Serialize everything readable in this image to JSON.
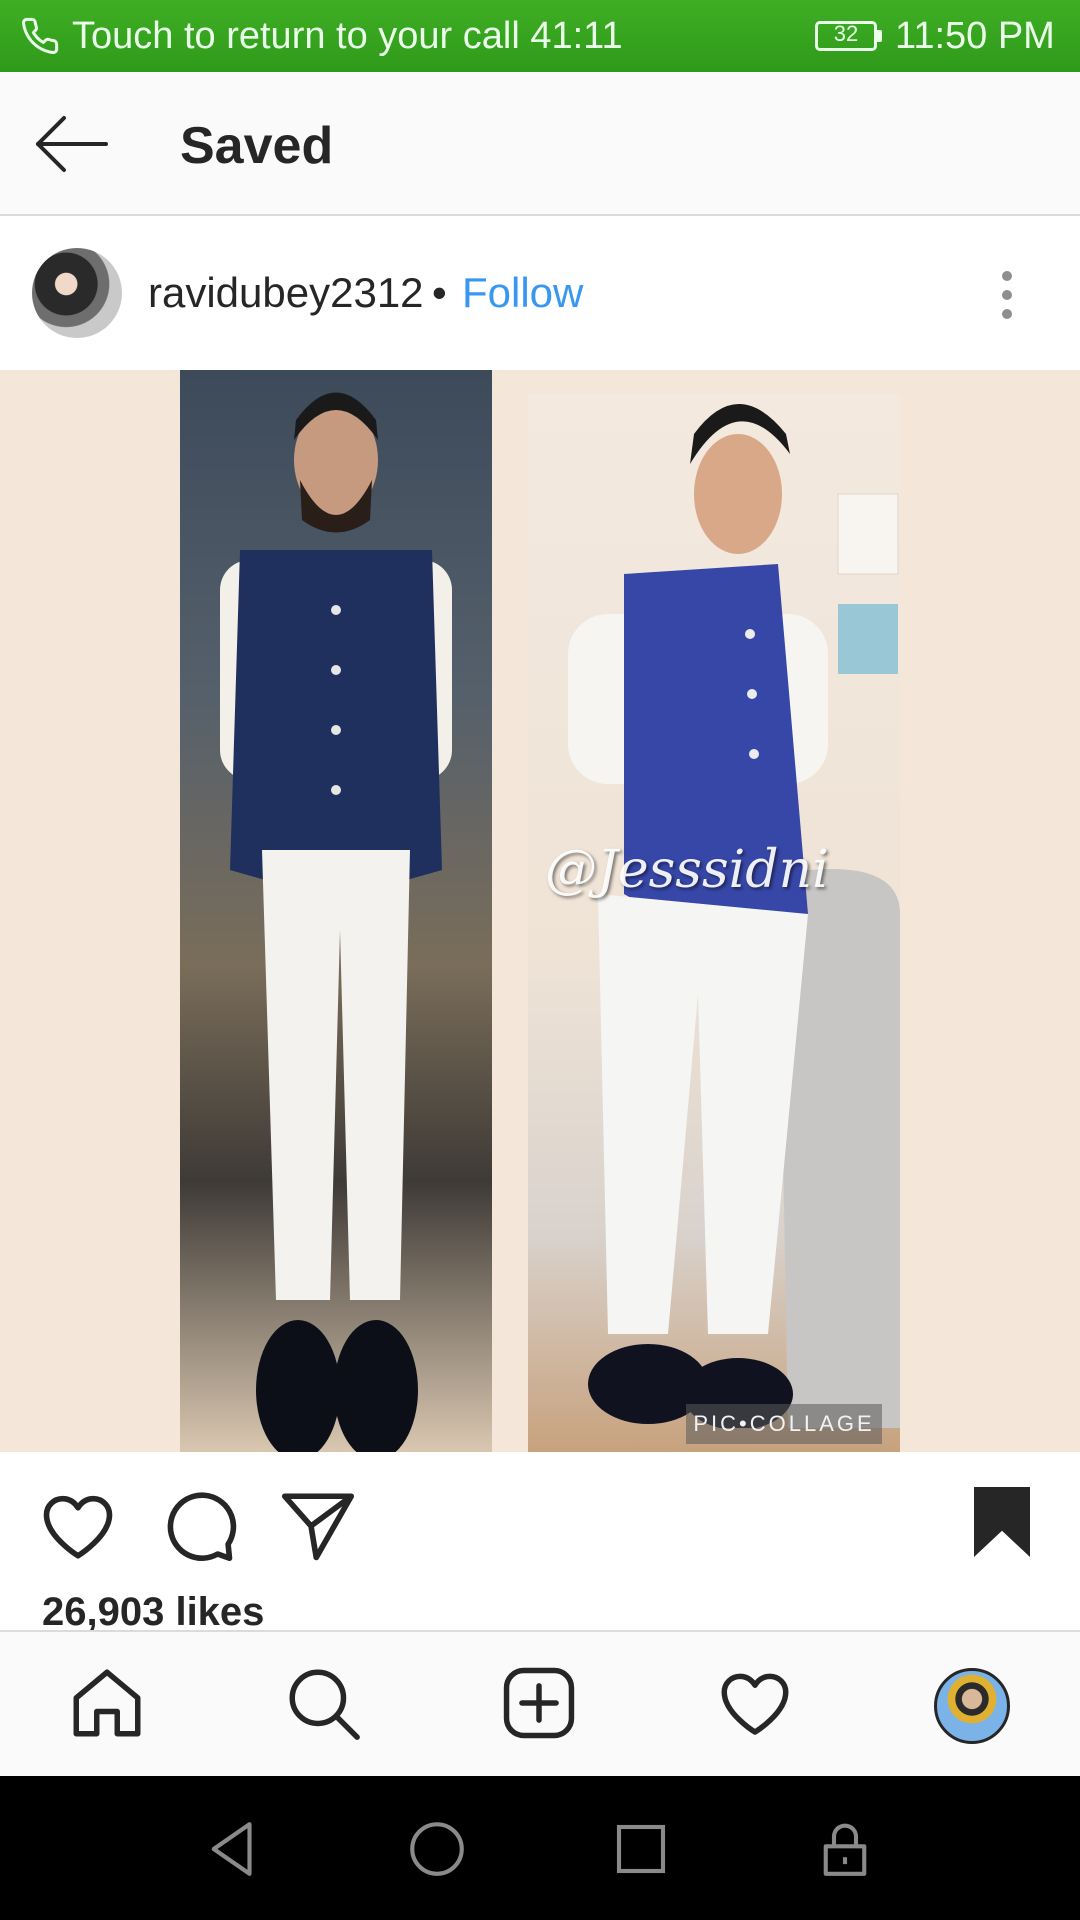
{
  "status_bar": {
    "call_text": "Touch to return to your call",
    "call_timer": "41:11",
    "battery": "32",
    "time": "11:50 PM"
  },
  "header": {
    "title": "Saved"
  },
  "post": {
    "username": "ravidubey2312",
    "separator": "•",
    "follow_label": "Follow",
    "image_watermark": "@Jesssidni",
    "collage_tag": "PIC•COLLAGE",
    "likes": "26,903 likes",
    "saved": true
  },
  "bottom_nav": {
    "items": [
      "home-icon",
      "search-icon",
      "add-post-icon",
      "activity-heart-icon",
      "profile-avatar"
    ]
  },
  "system_nav": {
    "items": [
      "back-icon",
      "home-circle-icon",
      "recents-icon",
      "lock-icon"
    ]
  },
  "colors": {
    "status_bar": "#3fae24",
    "follow_link": "#3897f0",
    "text": "#262626",
    "image_bg": "#f5e6da"
  }
}
